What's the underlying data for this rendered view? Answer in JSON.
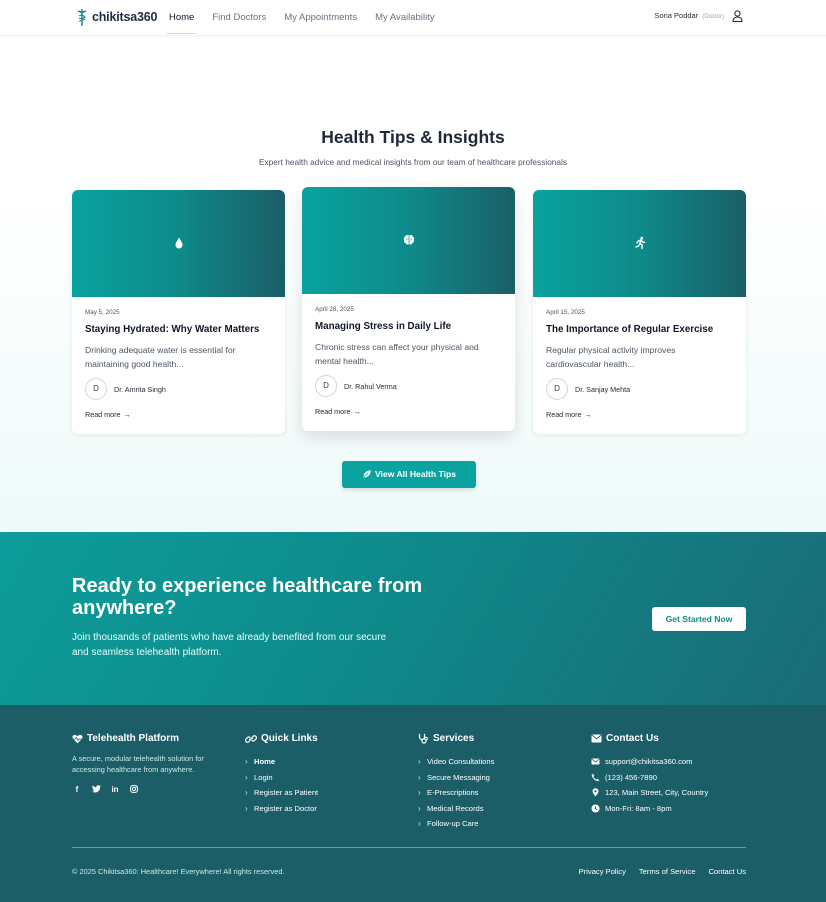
{
  "nav": {
    "brand": "chikitsa360",
    "links": [
      "Home",
      "Find Doctors",
      "My Appointments",
      "My Availability"
    ],
    "active_link": "Home",
    "user_name": "Sona Poddar",
    "user_role": "(Doctor)"
  },
  "tips": {
    "title": "Health Tips & Insights",
    "subtitle": "Expert health advice and medical insights from our team of healthcare professionals",
    "cards": [
      {
        "icon": "water-drop-icon",
        "date": "May 5, 2025",
        "title": "Staying Hydrated: Why Water Matters",
        "excerpt": "Drinking adequate water is essential for maintaining good health...",
        "avatar": "D",
        "author": "Dr. Amrita Singh",
        "read_more": "Read more"
      },
      {
        "icon": "brain-icon",
        "date": "April 28, 2025",
        "title": "Managing Stress in Daily Life",
        "excerpt": "Chronic stress can affect your physical and mental health...",
        "avatar": "D",
        "author": "Dr. Rahul Verma",
        "read_more": "Read more"
      },
      {
        "icon": "running-icon",
        "date": "April 15, 2025",
        "title": "The Importance of Regular Exercise",
        "excerpt": "Regular physical activity improves cardiovascular health...",
        "avatar": "D",
        "author": "Dr. Sanjay Mehta",
        "read_more": "Read more"
      }
    ],
    "view_all": "View All Health Tips"
  },
  "cta": {
    "title": "Ready to experience healthcare from anywhere?",
    "text": "Join thousands of patients who have already benefited from our secure and seamless telehealth platform.",
    "button": "Get Started Now"
  },
  "footer": {
    "platform": {
      "title": "Telehealth Platform",
      "description": "A secure, modular telehealth solution for accessing healthcare from anywhere.",
      "social": [
        "facebook-icon",
        "twitter-icon",
        "linkedin-icon",
        "instagram-icon"
      ]
    },
    "quick_links": {
      "title": "Quick Links",
      "items": [
        "Home",
        "Login",
        "Register as Patient",
        "Register as Doctor"
      ]
    },
    "services": {
      "title": "Services",
      "items": [
        "Video Consultations",
        "Secure Messaging",
        "E-Prescriptions",
        "Medical Records",
        "Follow-up Care"
      ]
    },
    "contact": {
      "title": "Contact Us",
      "email": "support@chikitsa360.com",
      "phone": "(123) 456-7890",
      "address": "123, Main Street, City, Country",
      "hours": "Mon-Fri: 8am - 8pm"
    },
    "copyright": "© 2025 Chikitsa360: Healthcare! Everywhere! All rights reserved.",
    "legal": [
      "Privacy Policy",
      "Terms of Service",
      "Contact Us"
    ]
  },
  "colors": {
    "accent": "#0aa39f",
    "footer_bg": "#1b5e68",
    "brand_text": "#1f2a44"
  }
}
